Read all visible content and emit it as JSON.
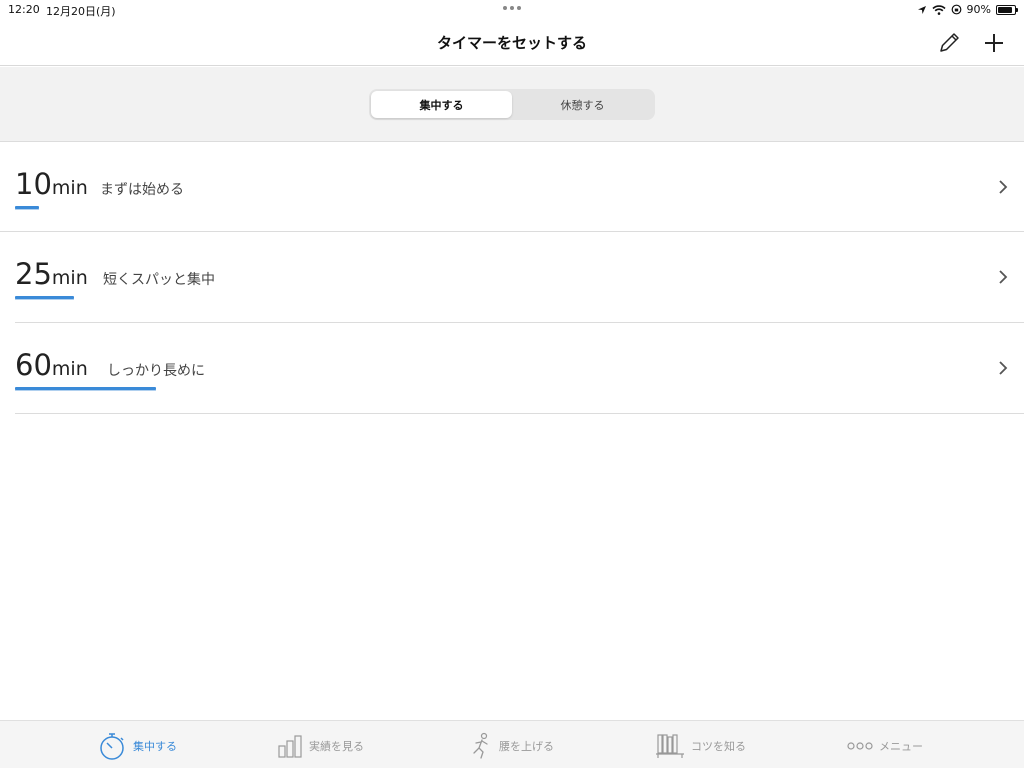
{
  "status_bar": {
    "time": "12:20",
    "date": "12月20日(月)",
    "battery": "90%",
    "battery_level": 0.9
  },
  "nav": {
    "title": "タイマーをセットする",
    "edit_icon": "pencil-icon",
    "add_icon": "plus-icon"
  },
  "segments": {
    "items": [
      {
        "label": "集中する",
        "active": true
      },
      {
        "label": "休憩する",
        "active": false
      }
    ]
  },
  "accent_color": "#3a8ad8",
  "timers": [
    {
      "number": "10",
      "unit": "min",
      "desc": "まずは始める",
      "level": 10
    },
    {
      "number": "25",
      "unit": "min",
      "desc": "短くスパッと集中",
      "level": 25
    },
    {
      "number": "60",
      "unit": "min",
      "desc": "しっかり長めに",
      "level": 60
    }
  ],
  "tabs": [
    {
      "label": "集中する",
      "icon": "stopwatch-icon",
      "active": true
    },
    {
      "label": "実績を見る",
      "icon": "bar-chart-icon",
      "active": false
    },
    {
      "label": "腰を上げる",
      "icon": "running-person-icon",
      "active": false
    },
    {
      "label": "コツを知る",
      "icon": "bookshelf-icon",
      "active": false
    },
    {
      "label": "メニュー",
      "icon": "more-icon",
      "active": false
    }
  ]
}
